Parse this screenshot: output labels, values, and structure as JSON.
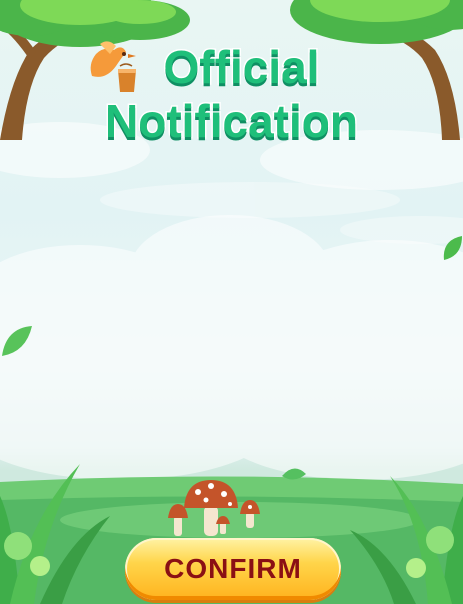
{
  "dialog": {
    "title_line1": "Official",
    "title_line2": "Notification"
  },
  "confirm": {
    "label": "CONFIRM"
  },
  "colors": {
    "title_green": "#1fbf7a",
    "button_yellow": "#ffd54a",
    "button_text": "#8a1014",
    "ground_green": "#5cc06a"
  },
  "icons": [
    "tree-icon",
    "bird-with-bucket-icon",
    "leaf-icon",
    "mushroom-icon",
    "grass-icon"
  ]
}
